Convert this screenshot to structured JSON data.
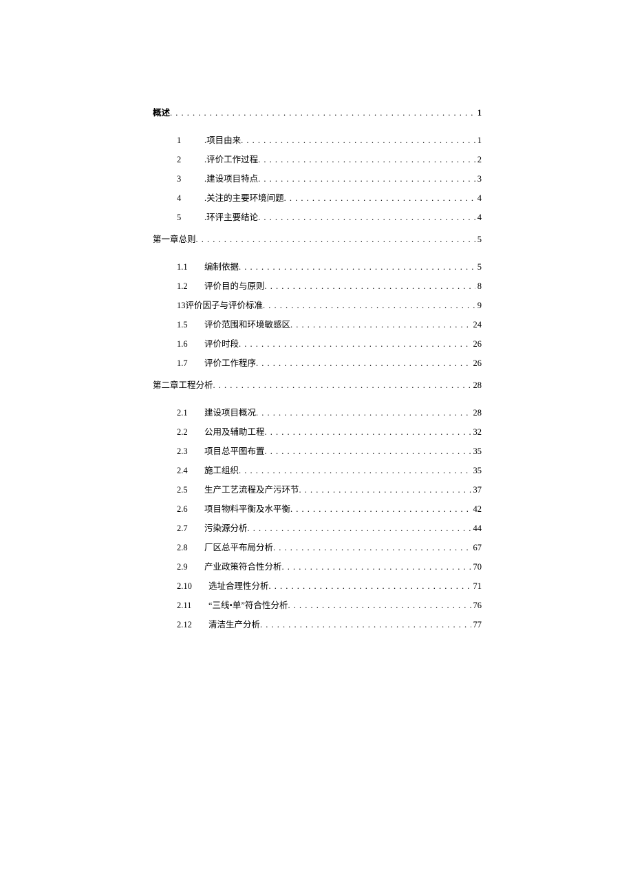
{
  "toc": [
    {
      "type": "heading",
      "num": "",
      "title": "概述",
      "page": "1",
      "bold": true
    },
    {
      "type": "sub",
      "num": "1",
      "title": ".项目由来",
      "page": "1"
    },
    {
      "type": "sub",
      "num": "2",
      "title": ".评价工作过程",
      "page": "2"
    },
    {
      "type": "sub",
      "num": "3",
      "title": ".建设项目特点",
      "page": "3"
    },
    {
      "type": "sub",
      "num": "4",
      "title": ".关注的主要环境间题",
      "page": "4"
    },
    {
      "type": "sub",
      "num": "5",
      "title": ".环评主要结论",
      "page": "4"
    },
    {
      "type": "heading",
      "num": "",
      "title": "第一章总则",
      "page": "5"
    },
    {
      "type": "sub",
      "num": "1.1",
      "title": "编制依据",
      "page": "5"
    },
    {
      "type": "sub",
      "num": "1.2",
      "title": "评价目的与原则",
      "page": "8"
    },
    {
      "type": "sub",
      "num": "",
      "title": "13评价因子与评价标准",
      "page": "9"
    },
    {
      "type": "sub",
      "num": "1.5",
      "title": "评价范围和环境敏感区",
      "page": "24"
    },
    {
      "type": "sub",
      "num": "1.6",
      "title": "评价时段",
      "page": "26"
    },
    {
      "type": "sub",
      "num": "1.7",
      "title": "评价工作程序",
      "page": "26"
    },
    {
      "type": "heading",
      "num": "",
      "title": "第二章工程分析",
      "page": "28"
    },
    {
      "type": "sub",
      "num": "2.1",
      "title": "建设项目概况",
      "page": "28"
    },
    {
      "type": "sub",
      "num": "2.2",
      "title": "公用及辅助工程",
      "page": "32"
    },
    {
      "type": "sub",
      "num": "2.3",
      "title": "项目总平图布置",
      "page": "35"
    },
    {
      "type": "sub",
      "num": "2.4",
      "title": "施工组织",
      "page": "35"
    },
    {
      "type": "sub",
      "num": "2.5",
      "title": "生产工艺流程及产污环节",
      "page": "37"
    },
    {
      "type": "sub",
      "num": "2.6",
      "title": "项目物料平衡及水平衡",
      "page": "42"
    },
    {
      "type": "sub",
      "num": "2.7",
      "title": "污染源分析",
      "page": "44"
    },
    {
      "type": "sub",
      "num": "2.8",
      "title": "厂区总平布局分析",
      "page": "67"
    },
    {
      "type": "sub",
      "num": "2.9",
      "title": "产业政策符合性分析",
      "page": "70"
    },
    {
      "type": "sub",
      "num": "2.10",
      "title": "选址合理性分析",
      "page": "71"
    },
    {
      "type": "sub",
      "num": "2.11",
      "title": "“三线•单”符合性分析",
      "page": "76"
    },
    {
      "type": "sub",
      "num": "2.12",
      "title": "清洁生产分析",
      "page": "77"
    }
  ]
}
